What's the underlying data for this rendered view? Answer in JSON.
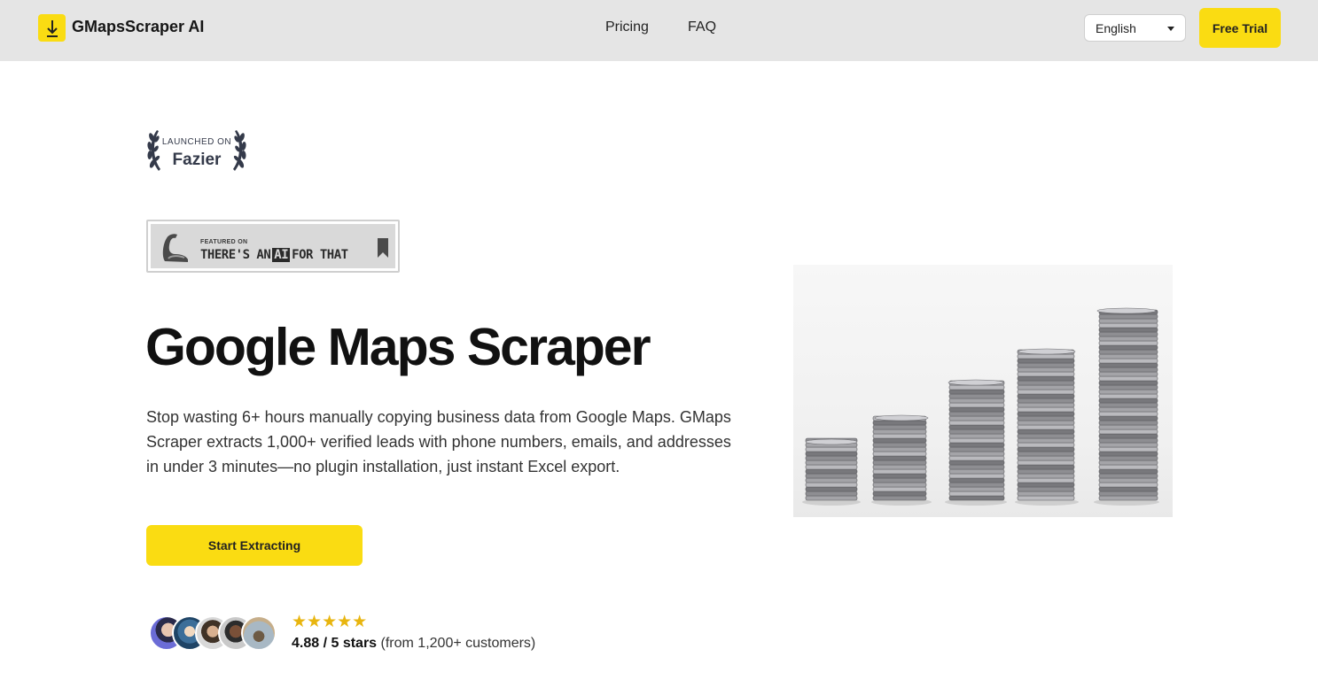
{
  "header": {
    "logo_text": "GMapsScraper AI",
    "nav": [
      {
        "label": "Pricing"
      },
      {
        "label": "FAQ"
      }
    ],
    "language": "English",
    "trial_label": "Free Trial"
  },
  "badges": {
    "fazier_small": "LAUNCHED ON",
    "fazier_big": "Fazier",
    "taaft_small": "FEATURED ON",
    "taaft_pre": "THERE'S AN",
    "taaft_ai": "AI",
    "taaft_post": "FOR THAT"
  },
  "hero": {
    "title": "Google Maps Scraper",
    "description": "Stop wasting 6+ hours manually copying business data from Google Maps. GMaps Scraper extracts 1,000+ verified leads with phone numbers, emails, and addresses in under 3 minutes—no plugin installation, just instant Excel export.",
    "cta_label": "Start Extracting"
  },
  "social_proof": {
    "stars": "★★★★★",
    "rating_bold": "4.88 / 5 stars",
    "rating_rest": "(from 1,200+ customers)",
    "star_count": 5
  },
  "colors": {
    "accent": "#fadc12",
    "header_bg": "#e5e5e5",
    "star": "#e8b50f"
  }
}
